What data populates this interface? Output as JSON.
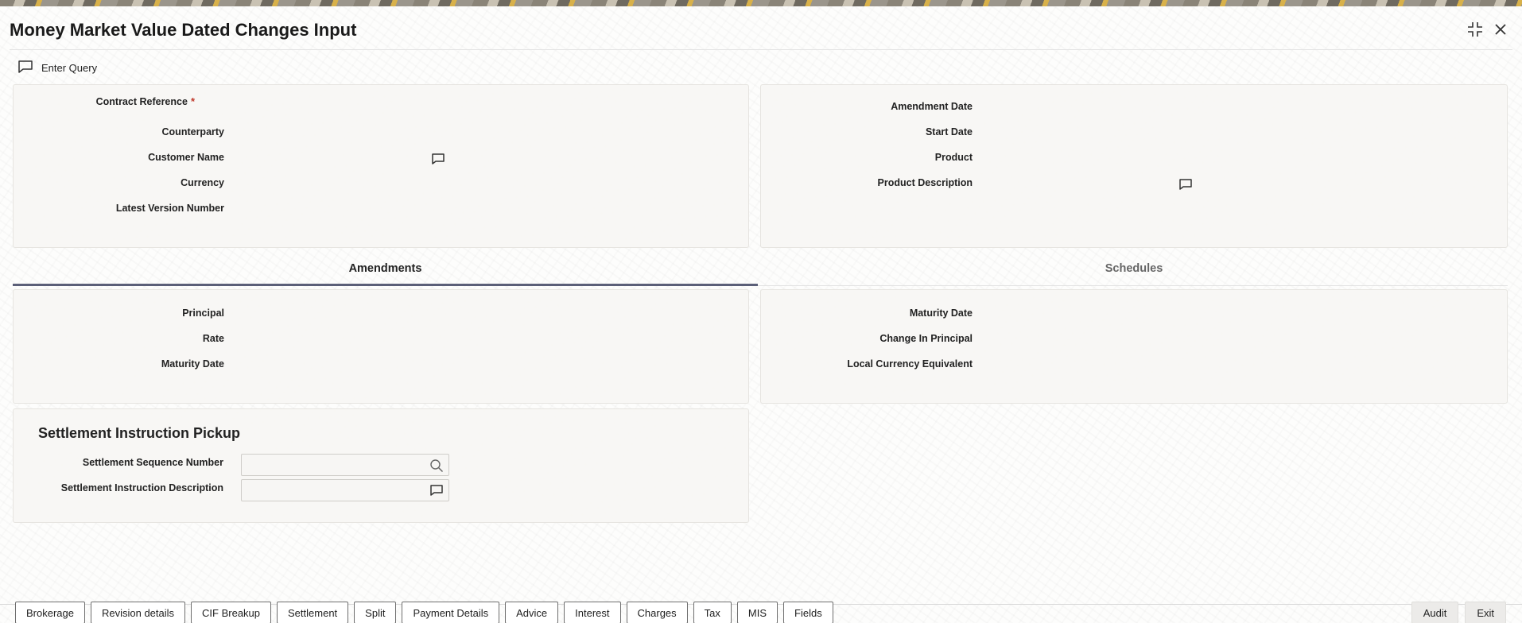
{
  "window": {
    "title": "Money Market Value Dated Changes Input",
    "maximize_icon": "compress-icon",
    "close_icon": "close-icon"
  },
  "toolbar": {
    "enter_query_label": "Enter Query",
    "enter_query_icon": "speech-bubble-icon"
  },
  "header_left": {
    "contract_reference": {
      "label": "Contract Reference",
      "required_mark": "*",
      "value": ""
    },
    "counterparty": {
      "label": "Counterparty",
      "value": ""
    },
    "customer_name": {
      "label": "Customer Name",
      "value": ""
    },
    "currency": {
      "label": "Currency",
      "value": ""
    },
    "latest_version_number": {
      "label": "Latest Version Number",
      "value": ""
    }
  },
  "header_right": {
    "amendment_date": {
      "label": "Amendment Date",
      "value": ""
    },
    "start_date": {
      "label": "Start Date",
      "value": ""
    },
    "product": {
      "label": "Product",
      "value": ""
    },
    "product_description": {
      "label": "Product Description",
      "value": ""
    }
  },
  "tabs": [
    {
      "label": "Amendments",
      "active": true
    },
    {
      "label": "Schedules",
      "active": false
    }
  ],
  "amendments": {
    "principal": {
      "label": "Principal",
      "value": ""
    },
    "rate": {
      "label": "Rate",
      "value": ""
    },
    "maturity_date": {
      "label": "Maturity Date",
      "value": ""
    }
  },
  "amendments_right": {
    "maturity_date": {
      "label": "Maturity Date",
      "value": ""
    },
    "change_in_principal": {
      "label": "Change In Principal",
      "value": ""
    },
    "local_currency_equivalent": {
      "label": "Local Currency Equivalent",
      "value": ""
    }
  },
  "settlement": {
    "title": "Settlement Instruction Pickup",
    "sequence_number": {
      "label": "Settlement Sequence Number",
      "value": ""
    },
    "instruction_description": {
      "label": "Settlement Instruction Description",
      "value": ""
    }
  },
  "footer": {
    "buttons": [
      "Brokerage",
      "Revision details",
      "CIF Breakup",
      "Settlement",
      "Split",
      "Payment Details",
      "Advice",
      "Interest",
      "Charges",
      "Tax",
      "MIS",
      "Fields"
    ],
    "audit_label": "Audit",
    "exit_label": "Exit"
  },
  "colors": {
    "tab_underline": "#5b5f78",
    "required": "#c0392b",
    "panel_bg": "#f7f6f4"
  }
}
